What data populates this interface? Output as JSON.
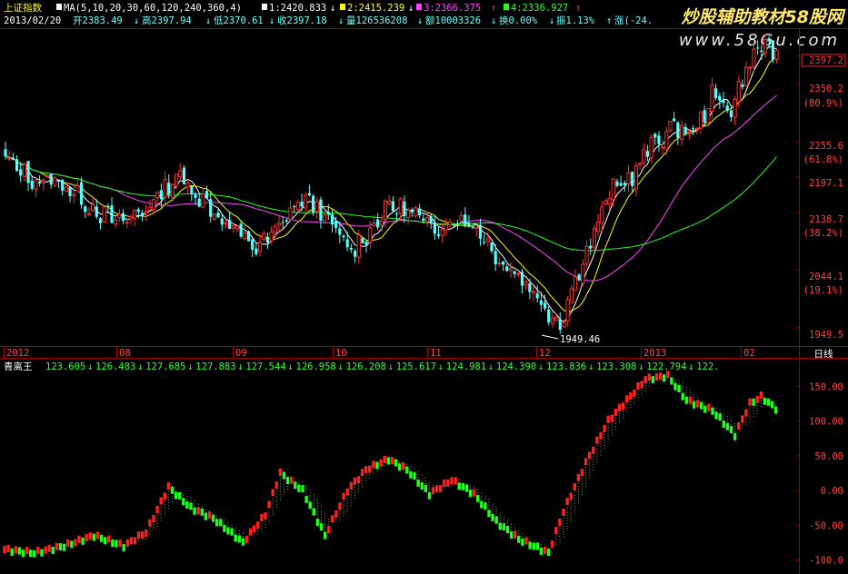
{
  "colors": {
    "background": "#000000",
    "frame": "#a00000",
    "grid": "#7a0000",
    "up": "#ff2d2d",
    "down": "#54ffff",
    "ma1": "#ffffff",
    "ma2": "#ffff00",
    "ma3": "#ff44ff",
    "ma4": "#22ff22",
    "text_white": "#ffffff",
    "text_yellow": "#ffff33",
    "text_green": "#33ff33",
    "text_magenta": "#ff44ff",
    "text_cyan": "#66ffff",
    "ind_up": "#ff2020",
    "ind_down": "#20ff20",
    "hatch": "#7fa060"
  },
  "header": {
    "index_name": "上证指数",
    "ma_params": "MA(5,10,20,30,60,120,240,360,4)",
    "ma1": "1:2420.833",
    "ma2": "2:2415.239",
    "ma3": "3:2366.375",
    "ma4": "4:2336.927",
    "date": "2013/02/20",
    "open": "开2383.49",
    "high": "高2397.94",
    "low": "低2370.61",
    "close": "收2397.18",
    "volume": "量126536208",
    "amount": "额10003326",
    "turnover": "换0.00%",
    "amplitude": "振1.13%",
    "change": "涨(-24."
  },
  "watermark": {
    "title": "炒股辅助教材58股网",
    "url": "www.58Gu.com"
  },
  "price_axis": {
    "labels": [
      {
        "text": "2350.2"
      },
      {
        "text": "(80.9%)"
      },
      {
        "text": "2255.6"
      },
      {
        "text": "(61.8%)"
      },
      {
        "text": "2197.1"
      },
      {
        "text": "2138.7"
      },
      {
        "text": "(38.2%)"
      },
      {
        "text": "2044.1"
      },
      {
        "text": "(19.1%)"
      },
      {
        "text": "1949.5"
      }
    ],
    "current": "2397.2"
  },
  "annotations": {
    "low_point": "1949.46"
  },
  "time_axis": {
    "labels": [
      "2012",
      "08",
      "09",
      "10",
      "11",
      "12",
      "2013",
      "02"
    ],
    "right_label": "日线"
  },
  "indicator": {
    "name": "青离王",
    "values": [
      {
        "text": "123.605",
        "arrow": "↓"
      },
      {
        "text": "126.483",
        "arrow": "↓"
      },
      {
        "text": "127.685",
        "arrow": "↓"
      },
      {
        "text": "127.883",
        "arrow": "↓"
      },
      {
        "text": "127.544",
        "arrow": "↓"
      },
      {
        "text": "126.958",
        "arrow": "↓"
      },
      {
        "text": "126.208",
        "arrow": "↓"
      },
      {
        "text": "125.617",
        "arrow": "↓"
      },
      {
        "text": "124.981",
        "arrow": "↓"
      },
      {
        "text": "124.390",
        "arrow": "↓"
      },
      {
        "text": "123.836",
        "arrow": "↓"
      },
      {
        "text": "123.308",
        "arrow": "↓"
      },
      {
        "text": "122.794",
        "arrow": "↓"
      },
      {
        "text": "122.",
        "arrow": ""
      }
    ],
    "axis_labels": [
      "150.00",
      "100.00",
      "50.00",
      "0.00",
      "-50.00",
      "-100.0"
    ]
  },
  "chart_data": [
    {
      "type": "candlestick",
      "title": "上证指数",
      "ylim": [
        1920,
        2440
      ],
      "y_ticks": [
        2350.2,
        2255.6,
        2197.1,
        2138.7,
        2044.1,
        1949.5
      ],
      "current_price": 2397.2,
      "low_marker": 1949.46,
      "grid": false,
      "anchors": [
        {
          "i": 0,
          "v": 2225
        },
        {
          "i": 8,
          "v": 2190
        },
        {
          "i": 14,
          "v": 2190
        },
        {
          "i": 22,
          "v": 2150
        },
        {
          "i": 30,
          "v": 2120
        },
        {
          "i": 38,
          "v": 2150
        },
        {
          "i": 45,
          "v": 2200
        },
        {
          "i": 52,
          "v": 2160
        },
        {
          "i": 58,
          "v": 2120
        },
        {
          "i": 66,
          "v": 2080
        },
        {
          "i": 71,
          "v": 2105
        },
        {
          "i": 76,
          "v": 2150
        },
        {
          "i": 80,
          "v": 2160
        },
        {
          "i": 86,
          "v": 2115
        },
        {
          "i": 91,
          "v": 2075
        },
        {
          "i": 96,
          "v": 2110
        },
        {
          "i": 101,
          "v": 2150
        },
        {
          "i": 107,
          "v": 2140
        },
        {
          "i": 112,
          "v": 2110
        },
        {
          "i": 118,
          "v": 2130
        },
        {
          "i": 124,
          "v": 2115
        },
        {
          "i": 130,
          "v": 2060
        },
        {
          "i": 136,
          "v": 2030
        },
        {
          "i": 141,
          "v": 1990
        },
        {
          "i": 146,
          "v": 1955
        },
        {
          "i": 150,
          "v": 2030
        },
        {
          "i": 154,
          "v": 2090
        },
        {
          "i": 159,
          "v": 2170
        },
        {
          "i": 165,
          "v": 2200
        },
        {
          "i": 170,
          "v": 2250
        },
        {
          "i": 176,
          "v": 2280
        },
        {
          "i": 181,
          "v": 2270
        },
        {
          "i": 186,
          "v": 2330
        },
        {
          "i": 191,
          "v": 2310
        },
        {
          "i": 196,
          "v": 2390
        },
        {
          "i": 200,
          "v": 2420
        },
        {
          "i": 203,
          "v": 2397
        }
      ],
      "moving_averages": [
        {
          "name": "1",
          "value": 2420.833
        },
        {
          "name": "2",
          "value": 2415.239
        },
        {
          "name": "3",
          "value": 2366.375
        },
        {
          "name": "4",
          "value": 2336.927
        }
      ],
      "x_labels": [
        "2012",
        "08",
        "09",
        "10",
        "11",
        "12",
        "2013",
        "02"
      ]
    },
    {
      "type": "bar",
      "title": "青离王",
      "ylim": [
        -115,
        170
      ],
      "y_ticks": [
        150,
        100,
        50,
        0,
        -50,
        -100
      ],
      "anchors": [
        {
          "i": 0,
          "v": -85
        },
        {
          "i": 8,
          "v": -90
        },
        {
          "i": 16,
          "v": -80
        },
        {
          "i": 24,
          "v": -65
        },
        {
          "i": 32,
          "v": -80
        },
        {
          "i": 38,
          "v": -60
        },
        {
          "i": 44,
          "v": 5
        },
        {
          "i": 50,
          "v": -25
        },
        {
          "i": 56,
          "v": -40
        },
        {
          "i": 64,
          "v": -75
        },
        {
          "i": 70,
          "v": -35
        },
        {
          "i": 74,
          "v": 25
        },
        {
          "i": 80,
          "v": 0
        },
        {
          "i": 86,
          "v": -65
        },
        {
          "i": 92,
          "v": 0
        },
        {
          "i": 97,
          "v": 30
        },
        {
          "i": 103,
          "v": 45
        },
        {
          "i": 108,
          "v": 30
        },
        {
          "i": 114,
          "v": -5
        },
        {
          "i": 120,
          "v": 15
        },
        {
          "i": 126,
          "v": -5
        },
        {
          "i": 132,
          "v": -45
        },
        {
          "i": 138,
          "v": -70
        },
        {
          "i": 146,
          "v": -90
        },
        {
          "i": 150,
          "v": -30
        },
        {
          "i": 156,
          "v": 40
        },
        {
          "i": 162,
          "v": 100
        },
        {
          "i": 167,
          "v": 130
        },
        {
          "i": 172,
          "v": 160
        },
        {
          "i": 178,
          "v": 165
        },
        {
          "i": 183,
          "v": 130
        },
        {
          "i": 190,
          "v": 115
        },
        {
          "i": 196,
          "v": 80
        },
        {
          "i": 200,
          "v": 125
        },
        {
          "i": 203,
          "v": 135
        },
        {
          "i": 207,
          "v": 118
        }
      ]
    }
  ]
}
